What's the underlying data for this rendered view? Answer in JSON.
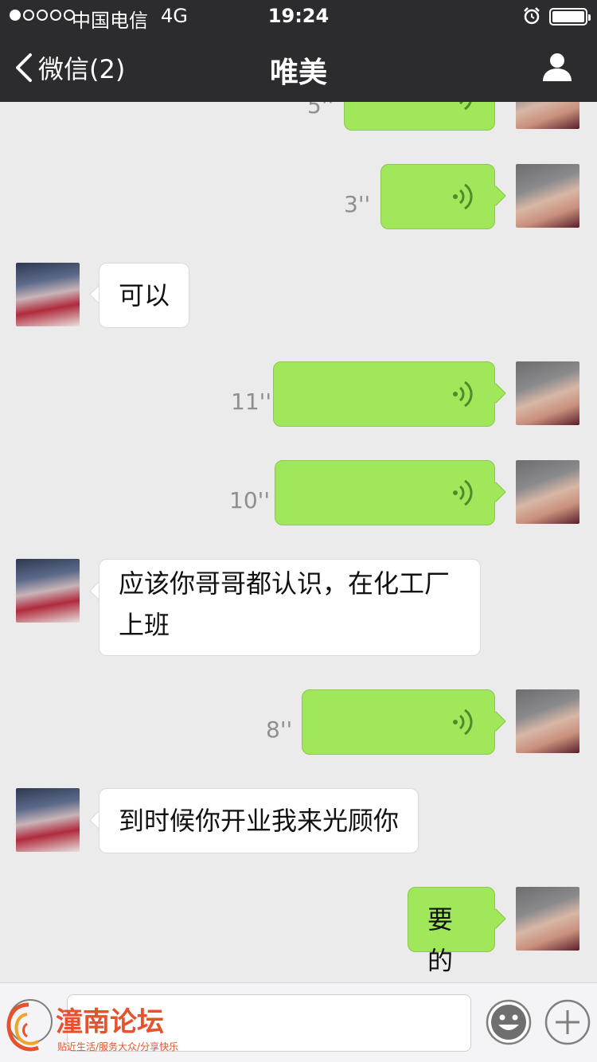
{
  "status_bar": {
    "carrier": "中国电信",
    "network": "4G",
    "time": "19:24"
  },
  "nav": {
    "back_label": "微信(2)",
    "title": "唯美"
  },
  "colors": {
    "nav_bg": "#2c2c2e",
    "chat_bg": "#ebebeb",
    "outgoing_bubble": "#a0e75a",
    "incoming_bubble": "#ffffff"
  },
  "messages": [
    {
      "side": "right",
      "type": "voice",
      "duration": "5''"
    },
    {
      "side": "right",
      "type": "voice",
      "duration": "3''"
    },
    {
      "side": "left",
      "type": "text",
      "text": "可以"
    },
    {
      "side": "right",
      "type": "voice",
      "duration": "11''"
    },
    {
      "side": "right",
      "type": "voice",
      "duration": "10''"
    },
    {
      "side": "left",
      "type": "text",
      "text_line1": "应该你哥哥都认识，在化工厂",
      "text_line2": "上班"
    },
    {
      "side": "right",
      "type": "voice",
      "duration": "8''"
    },
    {
      "side": "left",
      "type": "text",
      "text": "到时候你开业我来光顾你"
    },
    {
      "side": "right",
      "type": "text",
      "text": "要的"
    }
  ],
  "watermark": {
    "title": "潼南论坛",
    "subtitle": "贴近生活/服务大众/分享快乐"
  },
  "icons": {
    "back": "chevron-left-icon",
    "profile": "person-icon",
    "voice_wave": "voice-wave-icon",
    "emoji": "smiley-icon",
    "plus": "plus-icon"
  }
}
